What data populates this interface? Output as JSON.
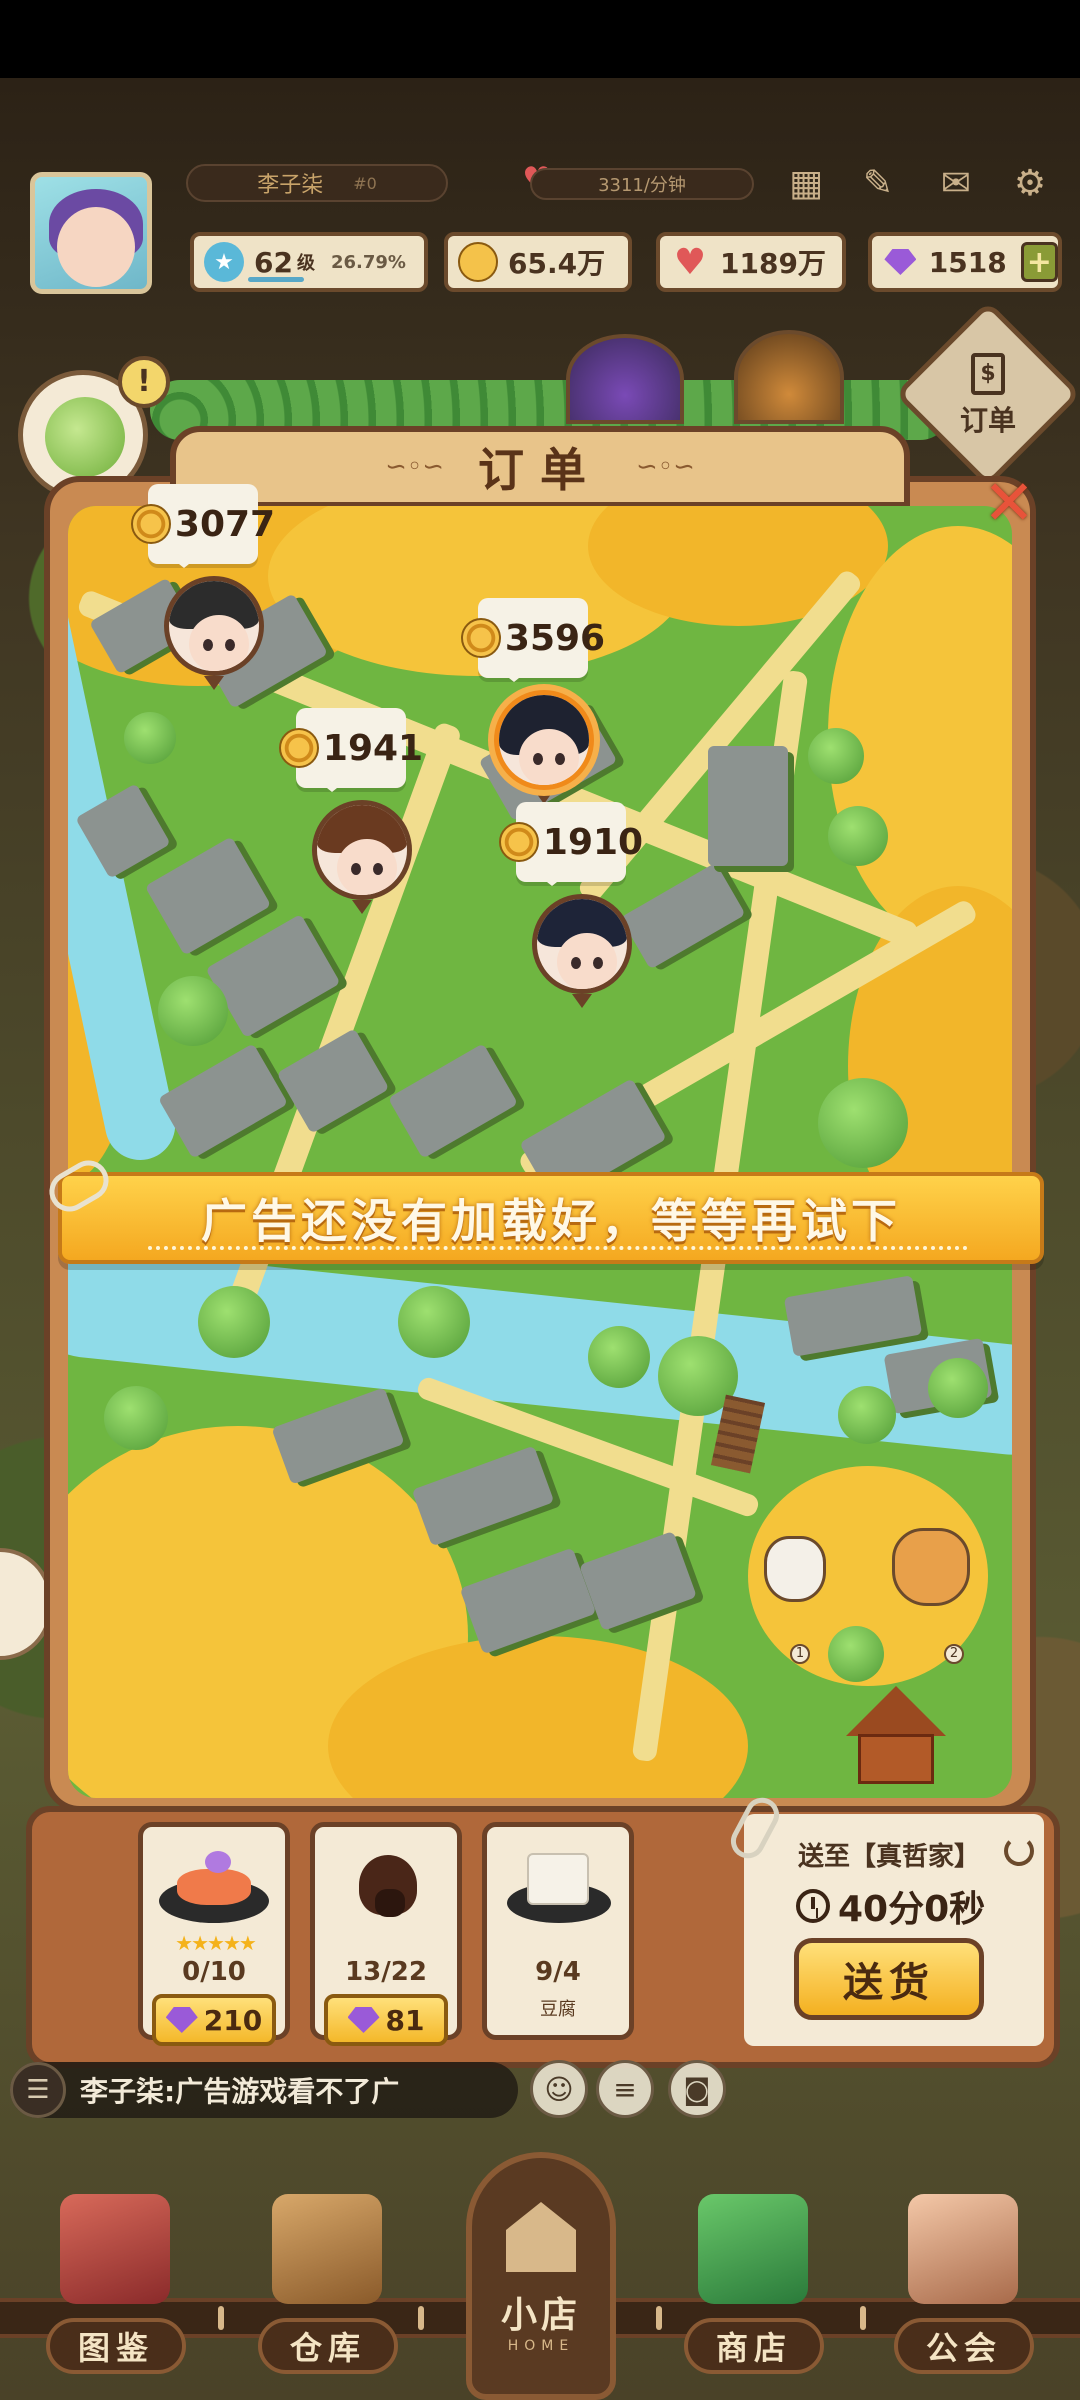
{
  "hud": {
    "player_name": "李子柒",
    "player_tag": "#0",
    "rate": "3311/分钟",
    "level": "62",
    "level_unit": "级",
    "level_progress": "26.79%",
    "coins": "65.4万",
    "hearts": "1189万",
    "gems": "1518",
    "plus": "+"
  },
  "orders_button": {
    "label": "订单",
    "icon": "$"
  },
  "panel": {
    "title": "订单",
    "title_ornament": "∽◦∽",
    "close": "✕"
  },
  "map_pins": [
    {
      "amount": "3077",
      "active": false
    },
    {
      "amount": "3596",
      "active": true
    },
    {
      "amount": "1941",
      "active": false
    },
    {
      "amount": "1910",
      "active": false
    }
  ],
  "pets": [
    {
      "num": "1"
    },
    {
      "num": "2"
    }
  ],
  "ad_banner": {
    "text": "广告还没有加载好，等等再试下"
  },
  "order_items": [
    {
      "qty": "0/10",
      "stars": "★★★★★",
      "price": "210",
      "sub": ""
    },
    {
      "qty": "13/22",
      "stars": "",
      "price": "81",
      "sub": ""
    },
    {
      "qty": "9/4",
      "stars": "",
      "price": "",
      "sub": "豆腐"
    }
  ],
  "delivery": {
    "to": "送至【真哲家】",
    "timer": "40分0秒",
    "button": "送货"
  },
  "chat": {
    "text": "李子柒:广告游戏看不了广"
  },
  "nav": [
    {
      "label": "图鉴"
    },
    {
      "label": "仓库"
    },
    {
      "label": "商店"
    },
    {
      "label": "公会"
    }
  ],
  "home": {
    "label": "小店",
    "sub": "HOME"
  },
  "colors": {
    "panel_border": "#6b4127",
    "accent_gold": "#f4b820",
    "map_green": "#6fb641",
    "foliage_yellow": "#f2b62a"
  }
}
